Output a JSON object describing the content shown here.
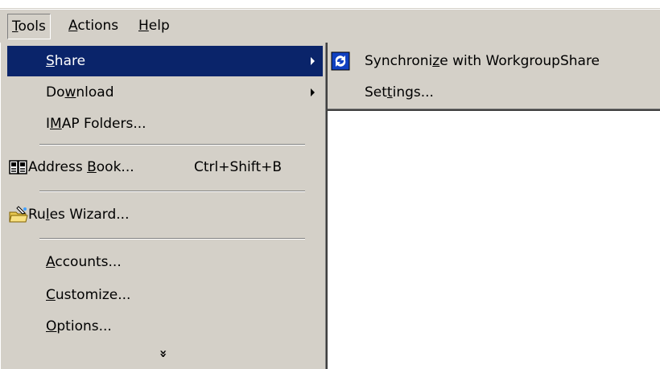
{
  "menubar": {
    "items": [
      {
        "label_pre": "",
        "label_key": "T",
        "label_post": "ools"
      },
      {
        "label_pre": "",
        "label_key": "A",
        "label_post": "ctions"
      },
      {
        "label_pre": "",
        "label_key": "H",
        "label_post": "elp"
      }
    ]
  },
  "tools_menu": {
    "share": {
      "pre": "",
      "key": "S",
      "post": "hare"
    },
    "download": {
      "pre": "Do",
      "key": "w",
      "post": "nload"
    },
    "imap": {
      "pre": "I",
      "key": "M",
      "post": "AP Folders..."
    },
    "address_book": {
      "pre": "Address ",
      "key": "B",
      "post": "ook...",
      "shortcut": "Ctrl+Shift+B",
      "icon": "address-book-icon"
    },
    "rules_wizard": {
      "pre": "Ru",
      "key": "l",
      "post": "es Wizard...",
      "icon": "rules-wizard-icon"
    },
    "accounts": {
      "pre": "",
      "key": "A",
      "post": "ccounts..."
    },
    "customize": {
      "pre": "",
      "key": "C",
      "post": "ustomize..."
    },
    "options": {
      "pre": "",
      "key": "O",
      "post": "ptions..."
    },
    "expand": "»"
  },
  "share_submenu": {
    "synchronize": {
      "pre": "Synchroni",
      "key": "z",
      "post": "e with WorkgroupShare",
      "icon": "sync-icon"
    },
    "settings": {
      "pre": "Set",
      "key": "t",
      "post": "ings..."
    }
  },
  "colors": {
    "menu_bg": "#d4d0c8",
    "highlight": "#0a246a",
    "highlight_text": "#ffffff"
  }
}
